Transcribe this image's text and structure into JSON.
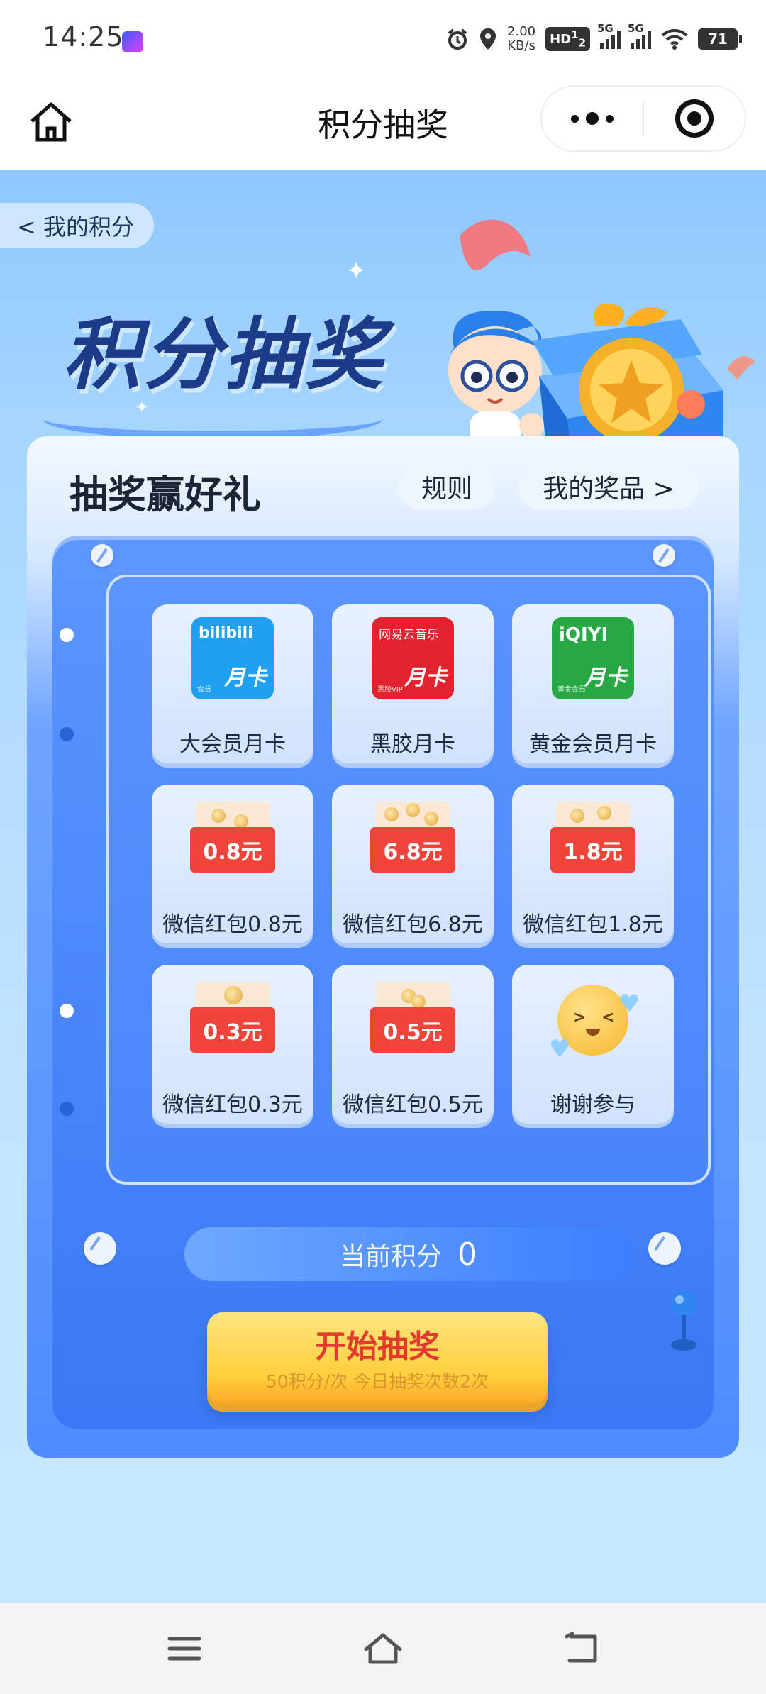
{
  "status_bar": {
    "time": "14:25",
    "speed_value": "2.00",
    "speed_unit": "KB/s",
    "hd_label": "HD",
    "sim_1": "1",
    "sim_2": "2",
    "network_1": "5G",
    "network_2": "5G",
    "battery": "71"
  },
  "title_bar": {
    "title": "积分抽奖"
  },
  "back_link": "< 我的积分",
  "hero": {
    "title": "积分抽奖"
  },
  "panel": {
    "heading": "抽奖赢好礼",
    "rules_label": "规则",
    "my_prizes_label": "我的奖品 >"
  },
  "prizes": [
    {
      "label": "大会员月卡",
      "brand": "bilibili",
      "card_text": "月卡",
      "small": "会员"
    },
    {
      "label": "黑胶月卡",
      "brand": "网易云音乐",
      "card_text": "月卡",
      "small": "黑胶VIP"
    },
    {
      "label": "黄金会员月卡",
      "brand": "iQIYI",
      "card_text": "月卡",
      "small": "黄金会员"
    },
    {
      "label": "微信红包0.8元",
      "amount": "0.8元"
    },
    {
      "label": "微信红包6.8元",
      "amount": "6.8元"
    },
    {
      "label": "微信红包1.8元",
      "amount": "1.8元"
    },
    {
      "label": "微信红包0.3元",
      "amount": "0.3元"
    },
    {
      "label": "微信红包0.5元",
      "amount": "0.5元"
    },
    {
      "label": "谢谢参与"
    }
  ],
  "points": {
    "label": "当前积分",
    "value": "0"
  },
  "draw_button": {
    "label": "开始抽奖",
    "sub_label": "50积分/次 今日抽奖次数2次"
  },
  "colors": {
    "bilibili": "#1fa0f0",
    "netease": "#e0232e",
    "iqiyi": "#27a844",
    "red_packet": "#f0433a",
    "accent_blue": "#3b7eff",
    "draw_button": "#ffcf3c"
  },
  "icons": {
    "home": "home-icon",
    "more": "more-dots-icon",
    "close": "target-close-icon",
    "nav_menu": "menu-icon",
    "nav_home": "home-outline-icon",
    "nav_back": "back-icon"
  }
}
